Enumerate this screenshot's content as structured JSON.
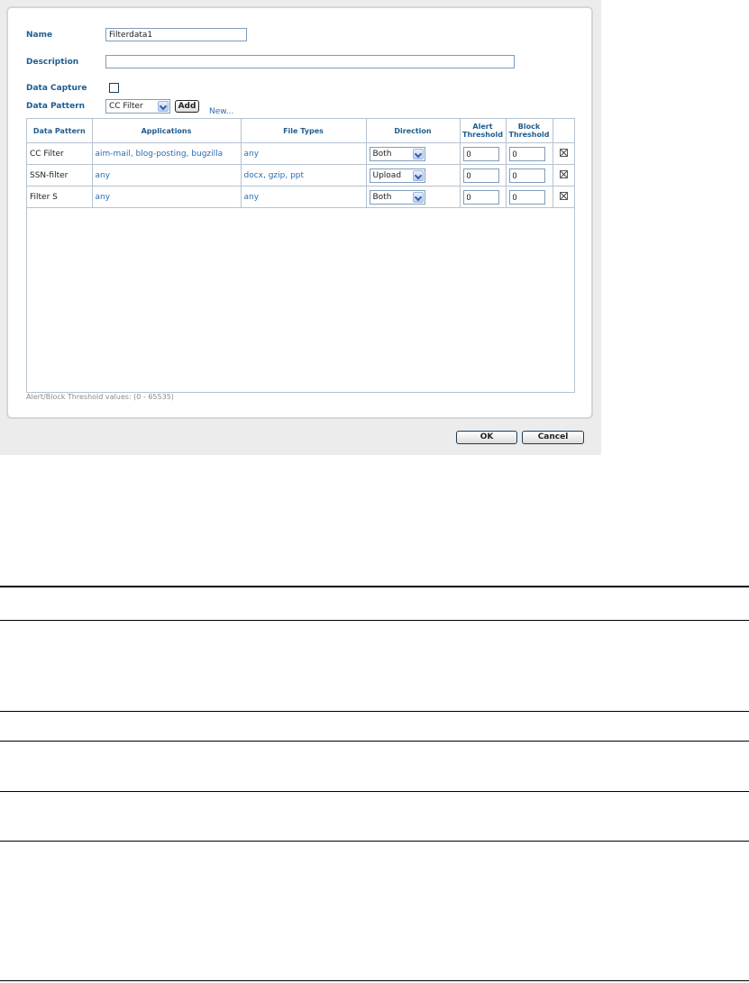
{
  "form": {
    "name_label": "Name",
    "name_value": "Filterdata1",
    "description_label": "Description",
    "description_value": "",
    "data_capture_label": "Data Capture",
    "data_capture_checked": false,
    "data_pattern_label": "Data Pattern",
    "data_pattern_selected": "CC Filter",
    "add_label": "Add",
    "new_link": "New..."
  },
  "table": {
    "headers": {
      "data_pattern": "Data Pattern",
      "applications": "Applications",
      "file_types": "File Types",
      "direction": "Direction",
      "alert_threshold": "Alert Threshold",
      "block_threshold": "Block Threshold"
    },
    "rows": [
      {
        "pattern": "CC Filter",
        "applications": "aim-mail, blog-posting, bugzilla",
        "file_types": "any",
        "direction": "Both",
        "alert": "0",
        "block": "0"
      },
      {
        "pattern": "SSN-filter",
        "applications": "any",
        "file_types": "docx, gzip, ppt",
        "direction": "Upload",
        "alert": "0",
        "block": "0"
      },
      {
        "pattern": "Filter S",
        "applications": "any",
        "file_types": "any",
        "direction": "Both",
        "alert": "0",
        "block": "0"
      }
    ]
  },
  "hint": "Alert/Block Threshold values: (0 - 65535)",
  "buttons": {
    "ok": "OK",
    "cancel": "Cancel"
  }
}
